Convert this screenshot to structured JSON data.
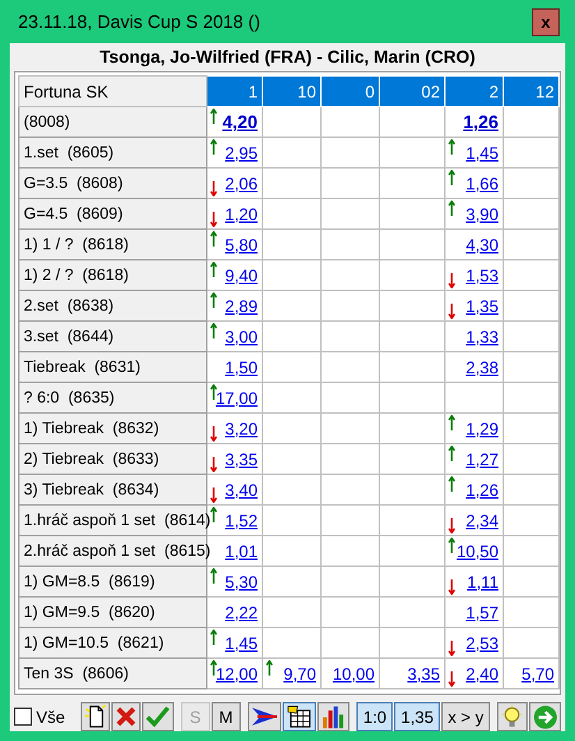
{
  "window": {
    "title": "23.11.18, Davis Cup S 2018 ()",
    "close": "x"
  },
  "match": "Tsonga, Jo-Wilfried (FRA) - Cilic, Marin (CRO)",
  "table": {
    "corner": "Fortuna SK",
    "columns": [
      "1",
      "10",
      "0",
      "02",
      "2",
      "12"
    ],
    "rows": [
      {
        "label": "(8008)",
        "bold": true,
        "cells": [
          {
            "odds": "4,20",
            "up": true,
            "down": false
          },
          null,
          null,
          null,
          {
            "odds": "1,26",
            "up": false,
            "down": false
          },
          null
        ]
      },
      {
        "label": "1.set  (8605)",
        "bold": false,
        "cells": [
          {
            "odds": "2,95",
            "up": true,
            "down": false
          },
          null,
          null,
          null,
          {
            "odds": "1,45",
            "up": true,
            "down": false
          },
          null
        ]
      },
      {
        "label": "G=3.5  (8608)",
        "bold": false,
        "cells": [
          {
            "odds": "2,06",
            "up": false,
            "down": true
          },
          null,
          null,
          null,
          {
            "odds": "1,66",
            "up": true,
            "down": false
          },
          null
        ]
      },
      {
        "label": "G=4.5  (8609)",
        "bold": false,
        "cells": [
          {
            "odds": "1,20",
            "up": false,
            "down": true
          },
          null,
          null,
          null,
          {
            "odds": "3,90",
            "up": true,
            "down": false
          },
          null
        ]
      },
      {
        "label": "1) 1 / ?  (8618)",
        "bold": false,
        "cells": [
          {
            "odds": "5,80",
            "up": true,
            "down": false
          },
          null,
          null,
          null,
          {
            "odds": "4,30",
            "up": false,
            "down": false
          },
          null
        ]
      },
      {
        "label": "1) 2 / ?  (8618)",
        "bold": false,
        "cells": [
          {
            "odds": "9,40",
            "up": true,
            "down": false
          },
          null,
          null,
          null,
          {
            "odds": "1,53",
            "up": false,
            "down": true
          },
          null
        ]
      },
      {
        "label": "2.set  (8638)",
        "bold": false,
        "cells": [
          {
            "odds": "2,89",
            "up": true,
            "down": false
          },
          null,
          null,
          null,
          {
            "odds": "1,35",
            "up": false,
            "down": true
          },
          null
        ]
      },
      {
        "label": "3.set  (8644)",
        "bold": false,
        "cells": [
          {
            "odds": "3,00",
            "up": true,
            "down": false
          },
          null,
          null,
          null,
          {
            "odds": "1,33",
            "up": false,
            "down": false
          },
          null
        ]
      },
      {
        "label": "Tiebreak  (8631)",
        "bold": false,
        "cells": [
          {
            "odds": "1,50",
            "up": false,
            "down": false
          },
          null,
          null,
          null,
          {
            "odds": "2,38",
            "up": false,
            "down": false
          },
          null
        ]
      },
      {
        "label": "? 6:0  (8635)",
        "bold": false,
        "cells": [
          {
            "odds": "17,00",
            "up": true,
            "down": false
          },
          null,
          null,
          null,
          null,
          null
        ]
      },
      {
        "label": "1) Tiebreak  (8632)",
        "bold": false,
        "cells": [
          {
            "odds": "3,20",
            "up": false,
            "down": true
          },
          null,
          null,
          null,
          {
            "odds": "1,29",
            "up": true,
            "down": false
          },
          null
        ]
      },
      {
        "label": "2) Tiebreak  (8633)",
        "bold": false,
        "cells": [
          {
            "odds": "3,35",
            "up": false,
            "down": true
          },
          null,
          null,
          null,
          {
            "odds": "1,27",
            "up": true,
            "down": false
          },
          null
        ]
      },
      {
        "label": "3) Tiebreak  (8634)",
        "bold": false,
        "cells": [
          {
            "odds": "3,40",
            "up": false,
            "down": true
          },
          null,
          null,
          null,
          {
            "odds": "1,26",
            "up": true,
            "down": false
          },
          null
        ]
      },
      {
        "label": "1.hráč aspoň 1 set  (8614)",
        "bold": false,
        "cells": [
          {
            "odds": "1,52",
            "up": true,
            "down": false
          },
          null,
          null,
          null,
          {
            "odds": "2,34",
            "up": false,
            "down": true
          },
          null
        ]
      },
      {
        "label": "2.hráč aspoň 1 set  (8615)",
        "bold": false,
        "cells": [
          {
            "odds": "1,01",
            "up": false,
            "down": false
          },
          null,
          null,
          null,
          {
            "odds": "10,50",
            "up": true,
            "down": false
          },
          null
        ]
      },
      {
        "label": "1) GM=8.5  (8619)",
        "bold": false,
        "cells": [
          {
            "odds": "5,30",
            "up": true,
            "down": false
          },
          null,
          null,
          null,
          {
            "odds": "1,11",
            "up": false,
            "down": true
          },
          null
        ]
      },
      {
        "label": "1) GM=9.5  (8620)",
        "bold": false,
        "cells": [
          {
            "odds": "2,22",
            "up": false,
            "down": false
          },
          null,
          null,
          null,
          {
            "odds": "1,57",
            "up": false,
            "down": false
          },
          null
        ]
      },
      {
        "label": "1) GM=10.5  (8621)",
        "bold": false,
        "cells": [
          {
            "odds": "1,45",
            "up": true,
            "down": false
          },
          null,
          null,
          null,
          {
            "odds": "2,53",
            "up": false,
            "down": true
          },
          null
        ]
      },
      {
        "label": "Ten 3S  (8606)",
        "bold": false,
        "cells": [
          {
            "odds": "12,00",
            "up": true,
            "down": false
          },
          {
            "odds": "9,70",
            "up": true,
            "down": false
          },
          {
            "odds": "10,00",
            "up": false,
            "down": false
          },
          {
            "odds": "3,35",
            "up": false,
            "down": false
          },
          {
            "odds": "2,40",
            "up": false,
            "down": true
          },
          {
            "odds": "5,70",
            "up": false,
            "down": false
          }
        ]
      }
    ]
  },
  "toolbar": {
    "all_checkbox": {
      "label": "Vše",
      "checked": false
    },
    "buttons": [
      {
        "kind": "new",
        "selected": false,
        "disabled": false
      },
      {
        "kind": "delete",
        "selected": false,
        "disabled": false
      },
      {
        "kind": "confirm",
        "selected": false,
        "disabled": false
      },
      {
        "kind": "text",
        "label": "S",
        "selected": false,
        "disabled": true
      },
      {
        "kind": "text",
        "label": "M",
        "selected": false,
        "disabled": false
      },
      {
        "kind": "send",
        "selected": false,
        "disabled": false
      },
      {
        "kind": "sheet",
        "selected": true,
        "disabled": false
      },
      {
        "kind": "chart",
        "selected": false,
        "disabled": false
      },
      {
        "kind": "text",
        "label": "1:0",
        "selected": true,
        "disabled": false
      },
      {
        "kind": "text",
        "label": "1,35",
        "selected": true,
        "disabled": false
      },
      {
        "kind": "text",
        "label": "x > y",
        "selected": false,
        "disabled": false
      },
      {
        "kind": "bulb",
        "selected": false,
        "disabled": false
      },
      {
        "kind": "go",
        "selected": false,
        "disabled": false
      }
    ]
  }
}
